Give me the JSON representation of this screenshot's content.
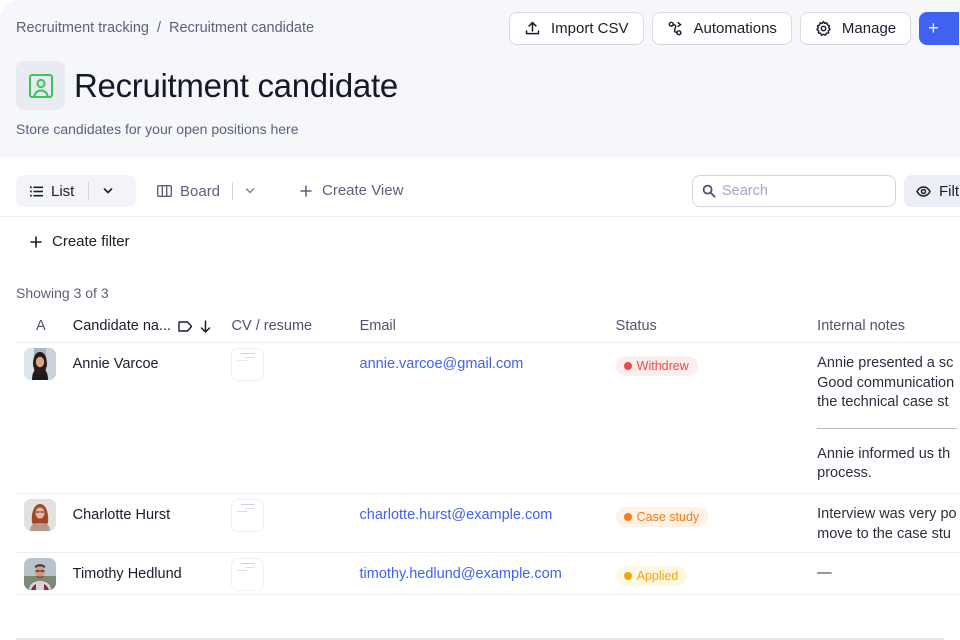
{
  "breadcrumb": [
    "Recruitment tracking",
    "Recruitment candidate"
  ],
  "breadcrumb_separator": "/",
  "actions": {
    "import_csv": "Import CSV",
    "automations": "Automations",
    "manage": "Manage",
    "add": "+"
  },
  "page": {
    "title": "Recruitment candidate",
    "subtitle": "Store candidates for your open positions here",
    "icon": "contact-card-icon",
    "icon_color": "#3cc35a"
  },
  "views": {
    "list_label": "List",
    "board_label": "Board",
    "create_view_label": "Create View",
    "search_placeholder": "Search",
    "search_value": "",
    "filter_label": "Filt"
  },
  "filters": {
    "create_filter_label": "Create filter"
  },
  "table": {
    "showing": "Showing 3 of 3",
    "columns": {
      "a": "A",
      "name": "Candidate na...",
      "cv": "CV / resume",
      "email": "Email",
      "status": "Status",
      "notes": "Internal notes"
    },
    "rows": [
      {
        "name": "Annie Varcoe",
        "email": "annie.varcoe@gmail.com",
        "status": "Withdrew",
        "status_color": "#f04848",
        "status_bg": "#fdeeee",
        "notes": [
          "Annie presented a sc",
          "Good communication",
          "the technical case st"
        ],
        "notes_2": [
          "Annie informed us th",
          "process."
        ]
      },
      {
        "name": "Charlotte Hurst",
        "email": "charlotte.hurst@example.com",
        "status": "Case study",
        "status_color": "#f57c17",
        "status_bg": "#fef2e6",
        "notes": [
          "Interview was very po",
          "move to the case stu"
        ]
      },
      {
        "name": "Timothy Hedlund",
        "email": "timothy.hedlund@example.com",
        "status": "Applied",
        "status_color": "#f5a50a",
        "status_bg": "#fef8df",
        "notes": [
          "—"
        ]
      }
    ]
  },
  "colors": {
    "accent": "#3f63f0",
    "link": "#3f63f0",
    "header_bg": "#f6f7fb"
  }
}
